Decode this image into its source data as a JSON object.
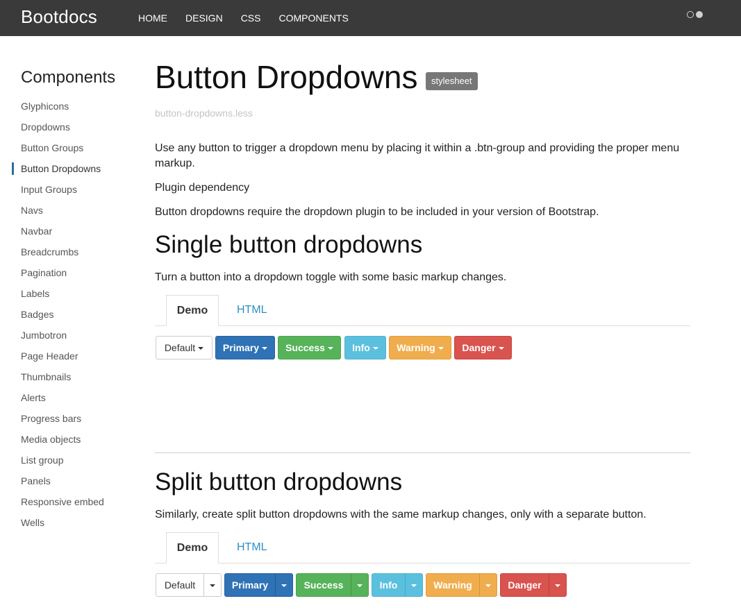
{
  "navbar": {
    "brand": "Bootdocs",
    "links": [
      "HOME",
      "DESIGN",
      "CSS",
      "COMPONENTS"
    ]
  },
  "sidebar": {
    "title": "Components",
    "items": [
      "Glyphicons",
      "Dropdowns",
      "Button Groups",
      "Button Dropdowns",
      "Input Groups",
      "Navs",
      "Navbar",
      "Breadcrumbs",
      "Pagination",
      "Labels",
      "Badges",
      "Jumbotron",
      "Page Header",
      "Thumbnails",
      "Alerts",
      "Progress bars",
      "Media objects",
      "List group",
      "Panels",
      "Responsive embed",
      "Wells"
    ],
    "active": "Button Dropdowns"
  },
  "main": {
    "title": "Button Dropdowns",
    "badge": "stylesheet",
    "less_file": "button-dropdowns.less",
    "intro": "Use any button to trigger a dropdown menu by placing it within a .btn-group and providing the proper menu markup.",
    "plugin_heading": "Plugin dependency",
    "plugin_text": "Button dropdowns require the dropdown plugin to be included in your version of Bootstrap.",
    "single": {
      "heading": "Single button dropdowns",
      "text": "Turn a button into a dropdown toggle with some basic markup changes.",
      "tab_demo": "Demo",
      "tab_html": "HTML"
    },
    "split": {
      "heading": "Split button dropdowns",
      "text": "Similarly, create split button dropdowns with the same markup changes, only with a separate button.",
      "tab_demo": "Demo",
      "tab_html": "HTML"
    },
    "buttons": {
      "default": "Default",
      "primary": "Primary",
      "success": "Success",
      "info": "Info",
      "warning": "Warning",
      "danger": "Danger"
    }
  },
  "colors": {
    "navbar_bg": "#3a3a3a",
    "primary": "#2f72b6",
    "success": "#56b35a",
    "info": "#5bc0de",
    "warning": "#f0ad4e",
    "danger": "#d9534f",
    "link": "#2a8fc4",
    "active_marker": "#2a6f97"
  }
}
